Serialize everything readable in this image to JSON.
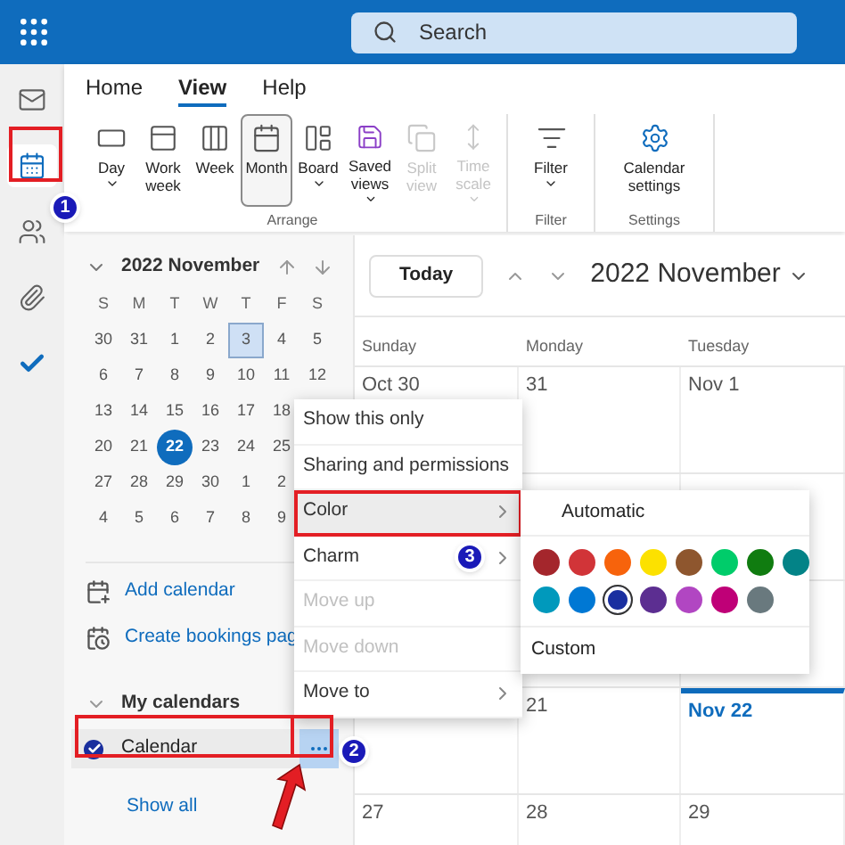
{
  "top_bar": {
    "search": {
      "placeholder": "Search"
    }
  },
  "rail": [
    {
      "kind": "mail",
      "selected": false
    },
    {
      "kind": "calendar",
      "selected": true
    },
    {
      "kind": "people",
      "selected": false
    },
    {
      "kind": "files",
      "selected": false
    },
    {
      "kind": "todo",
      "selected": false
    }
  ],
  "ribbon": {
    "tabs": [
      {
        "label": "Home",
        "selected": false
      },
      {
        "label": "View",
        "selected": true
      },
      {
        "label": "Help",
        "selected": false
      }
    ],
    "groups": [
      {
        "label": "Arrange",
        "buttons": [
          {
            "kind": "day",
            "label": "Day",
            "dropdown": true,
            "selected": false,
            "disabled": false
          },
          {
            "kind": "workweek",
            "label": "Work week",
            "dropdown": false,
            "selected": false,
            "disabled": false
          },
          {
            "kind": "week",
            "label": "Week",
            "dropdown": false,
            "selected": false,
            "disabled": false
          },
          {
            "kind": "month",
            "label": "Month",
            "dropdown": false,
            "selected": true,
            "disabled": false
          },
          {
            "kind": "board",
            "label": "Board",
            "dropdown": true,
            "selected": false,
            "disabled": false
          },
          {
            "kind": "saved",
            "label": "Saved views",
            "dropdown": true,
            "selected": false,
            "disabled": false
          },
          {
            "kind": "split",
            "label": "Split view",
            "dropdown": false,
            "selected": false,
            "disabled": true
          },
          {
            "kind": "timescale",
            "label": "Time scale",
            "dropdown": true,
            "selected": false,
            "disabled": true
          }
        ]
      },
      {
        "label": "Filter",
        "buttons": [
          {
            "kind": "filter",
            "label": "Filter",
            "dropdown": true,
            "selected": false,
            "disabled": false
          }
        ]
      },
      {
        "label": "Settings",
        "buttons": [
          {
            "kind": "settings",
            "label": "Calendar settings",
            "dropdown": false,
            "selected": false,
            "disabled": false
          }
        ]
      }
    ]
  },
  "mini_calendar": {
    "title": "2022 November",
    "weekdays": [
      "S",
      "M",
      "T",
      "W",
      "T",
      "F",
      "S"
    ],
    "weeks": [
      [
        {
          "label": "30",
          "selected": false,
          "today": false
        },
        {
          "label": "31",
          "selected": false,
          "today": false
        },
        {
          "label": "1",
          "selected": false,
          "today": false
        },
        {
          "label": "2",
          "selected": false,
          "today": false
        },
        {
          "label": "3",
          "selected": true,
          "today": false
        },
        {
          "label": "4",
          "selected": false,
          "today": false
        },
        {
          "label": "5",
          "selected": false,
          "today": false
        }
      ],
      [
        {
          "label": "6",
          "selected": false,
          "today": false
        },
        {
          "label": "7",
          "selected": false,
          "today": false
        },
        {
          "label": "8",
          "selected": false,
          "today": false
        },
        {
          "label": "9",
          "selected": false,
          "today": false
        },
        {
          "label": "10",
          "selected": false,
          "today": false
        },
        {
          "label": "11",
          "selected": false,
          "today": false
        },
        {
          "label": "12",
          "selected": false,
          "today": false
        }
      ],
      [
        {
          "label": "13",
          "selected": false,
          "today": false
        },
        {
          "label": "14",
          "selected": false,
          "today": false
        },
        {
          "label": "15",
          "selected": false,
          "today": false
        },
        {
          "label": "16",
          "selected": false,
          "today": false
        },
        {
          "label": "17",
          "selected": false,
          "today": false
        },
        {
          "label": "18",
          "selected": false,
          "today": false
        }
      ],
      [
        {
          "label": "20",
          "selected": false,
          "today": false
        },
        {
          "label": "21",
          "selected": false,
          "today": false
        },
        {
          "label": "22",
          "selected": false,
          "today": true
        },
        {
          "label": "23",
          "selected": false,
          "today": false
        },
        {
          "label": "24",
          "selected": false,
          "today": false
        },
        {
          "label": "25",
          "selected": false,
          "today": false
        }
      ],
      [
        {
          "label": "27",
          "selected": false,
          "today": false
        },
        {
          "label": "28",
          "selected": false,
          "today": false
        },
        {
          "label": "29",
          "selected": false,
          "today": false
        },
        {
          "label": "30",
          "selected": false,
          "today": false
        },
        {
          "label": "1",
          "selected": false,
          "today": false
        },
        {
          "label": "2",
          "selected": false,
          "today": false
        }
      ],
      [
        {
          "label": "4",
          "selected": false,
          "today": false
        },
        {
          "label": "5",
          "selected": false,
          "today": false
        },
        {
          "label": "6",
          "selected": false,
          "today": false
        },
        {
          "label": "7",
          "selected": false,
          "today": false
        },
        {
          "label": "8",
          "selected": false,
          "today": false
        },
        {
          "label": "9",
          "selected": false,
          "today": false
        }
      ]
    ]
  },
  "sidebar_links": [
    {
      "kind": "add",
      "label": "Add calendar"
    },
    {
      "kind": "bookings",
      "label": "Create bookings pag"
    }
  ],
  "my_calendars": {
    "title": "My calendars",
    "expanded": true,
    "items": [
      {
        "label": "Calendar",
        "checked": true
      }
    ],
    "show_all": "Show all"
  },
  "main": {
    "today_button": "Today",
    "title": "2022 November",
    "columns": [
      "Sunday",
      "Monday",
      "Tuesday"
    ],
    "weeks": [
      {
        "cells": [
          {
            "label": "Oct 30",
            "today": false
          },
          {
            "label": "31",
            "today": false
          },
          {
            "label": "Nov 1",
            "today": false
          }
        ]
      },
      {
        "cells": [
          {},
          {},
          {}
        ]
      },
      {
        "cells": [
          {},
          {},
          {}
        ]
      },
      {
        "cells": [
          {},
          {
            "label": "21",
            "today": false
          },
          {
            "label": "Nov 22",
            "today": true
          }
        ]
      },
      {
        "cells": [
          {
            "label": "27",
            "today": false
          },
          {
            "label": "28",
            "today": false
          },
          {
            "label": "29",
            "today": false
          }
        ]
      }
    ]
  },
  "context_menu": {
    "items": [
      {
        "label": "Show this only",
        "disabled": false,
        "submenu": false,
        "selected": false
      },
      {
        "label": "Sharing and permissions",
        "disabled": false,
        "submenu": false,
        "selected": false
      },
      {
        "label": "Color",
        "disabled": false,
        "submenu": true,
        "selected": true
      },
      {
        "label": "Charm",
        "disabled": false,
        "submenu": true,
        "selected": false
      },
      {
        "label": "Move up",
        "disabled": true,
        "submenu": false,
        "selected": false
      },
      {
        "label": "Move down",
        "disabled": true,
        "submenu": false,
        "selected": false
      },
      {
        "label": "Move to",
        "disabled": false,
        "submenu": true,
        "selected": false
      }
    ]
  },
  "color_menu": {
    "automatic": "Automatic",
    "custom": "Custom",
    "swatches": [
      {
        "color": "#a4262c",
        "selected": false
      },
      {
        "color": "#d13438",
        "selected": false
      },
      {
        "color": "#f7630c",
        "selected": false
      },
      {
        "color": "#fce100",
        "selected": false
      },
      {
        "color": "#8e562e",
        "selected": false
      },
      {
        "color": "#00cc6a",
        "selected": false
      },
      {
        "color": "#107c10",
        "selected": false
      },
      {
        "color": "#038387",
        "selected": false
      },
      {
        "color": "#0099bc",
        "selected": false
      },
      {
        "color": "#0078d4",
        "selected": false
      },
      {
        "color": "#1a2fa0",
        "selected": true
      },
      {
        "color": "#5c2e91",
        "selected": false
      },
      {
        "color": "#b146c2",
        "selected": false
      },
      {
        "color": "#bf0077",
        "selected": false
      },
      {
        "color": "#69797e",
        "selected": false
      }
    ]
  },
  "step_badges": [
    {
      "label": "1"
    },
    {
      "label": "2"
    },
    {
      "label": "3"
    }
  ]
}
